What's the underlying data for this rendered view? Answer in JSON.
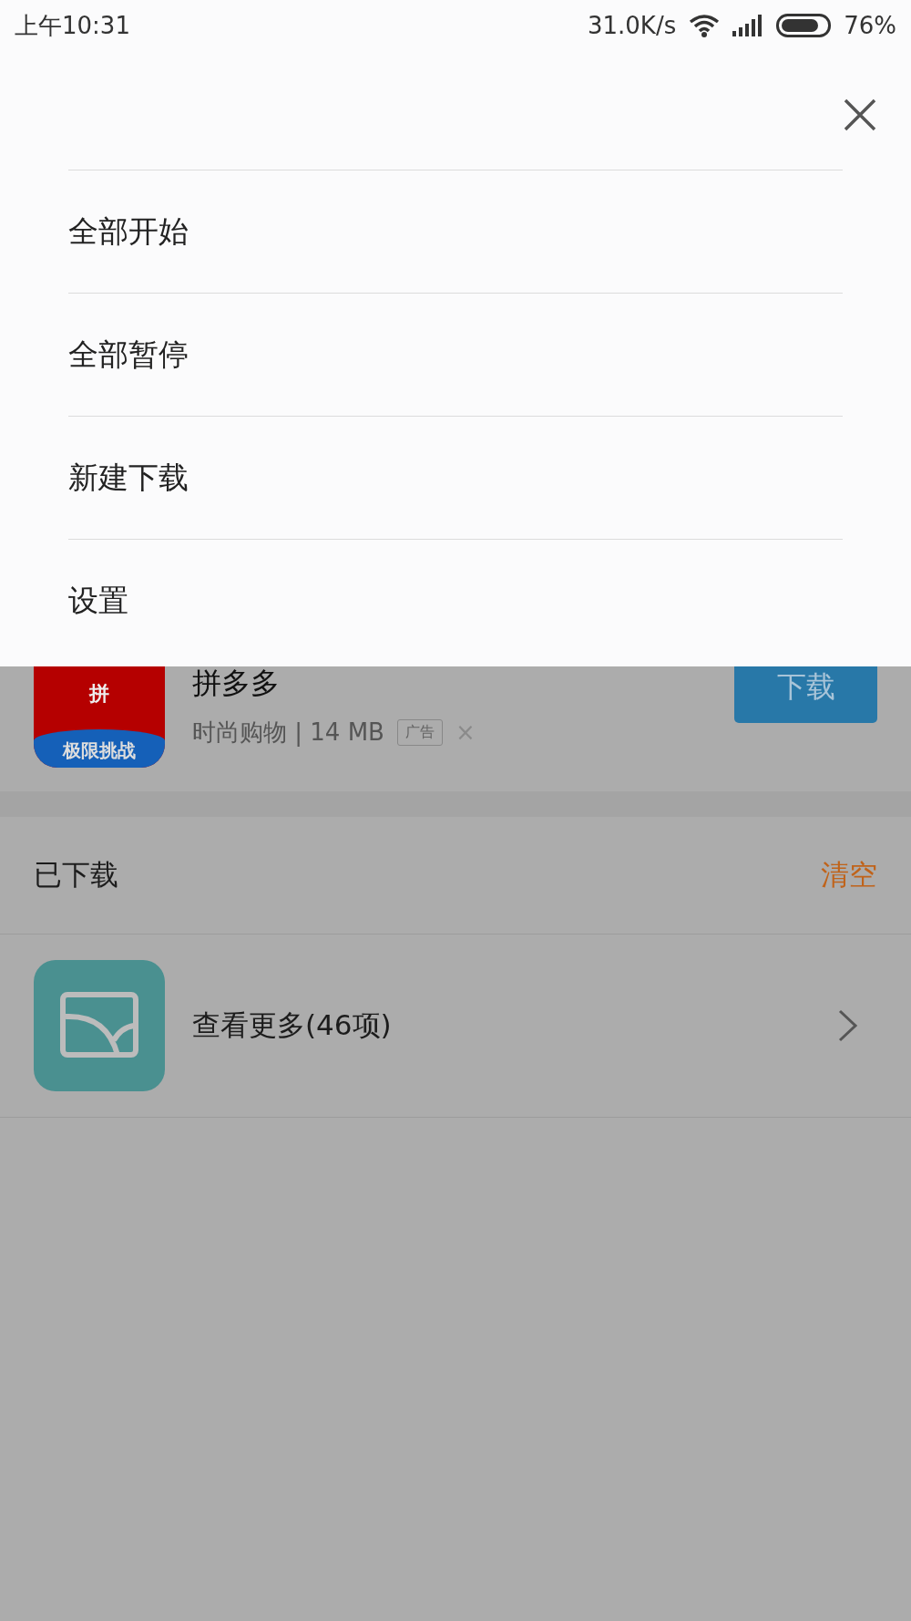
{
  "status_bar": {
    "time": "上午10:31",
    "speed": "31.0K/s",
    "battery": "76%"
  },
  "menu": {
    "items": [
      {
        "label": "全部开始"
      },
      {
        "label": "全部暂停"
      },
      {
        "label": "新建下载"
      },
      {
        "label": "设置"
      }
    ]
  },
  "ad": {
    "name": "拼多多",
    "icon_glyph": "拼",
    "icon_label": "极限挑战",
    "meta": "时尚购物 | 14 MB",
    "tag": "广告",
    "dismiss": "×",
    "button": "下载"
  },
  "downloaded": {
    "title": "已下载",
    "clear": "清空",
    "more": "查看更多(46项)"
  }
}
